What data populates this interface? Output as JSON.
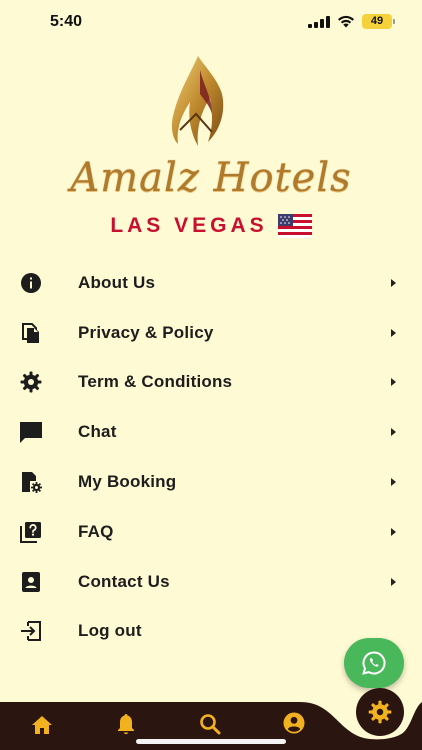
{
  "status_bar": {
    "time": "5:40",
    "battery": "49",
    "battery_color": "#F5D23B"
  },
  "brand": {
    "name": "Amalz Hotels",
    "location": "LAS VEGAS",
    "name_color": "#B07A2A",
    "location_color": "#C8102E"
  },
  "menu": {
    "items": [
      {
        "label": "About Us",
        "icon": "info-icon"
      },
      {
        "label": "Privacy & Policy",
        "icon": "documents-icon"
      },
      {
        "label": "Term & Conditions",
        "icon": "gear-icon"
      },
      {
        "label": "Chat",
        "icon": "chat-bubble-icon"
      },
      {
        "label": "My Booking",
        "icon": "booking-icon"
      },
      {
        "label": "FAQ",
        "icon": "help-icon"
      },
      {
        "label": "Contact Us",
        "icon": "contact-card-icon"
      },
      {
        "label": "Log out",
        "icon": "logout-icon"
      }
    ]
  },
  "fab": {
    "icon": "whatsapp-icon",
    "color": "#49B85A"
  },
  "bottom_nav": {
    "background": "#2B1510",
    "accent": "#F2B21F",
    "items": [
      {
        "icon": "home-icon"
      },
      {
        "icon": "bell-icon"
      },
      {
        "icon": "search-icon"
      },
      {
        "icon": "account-icon"
      },
      {
        "icon": "settings-icon",
        "active": true
      }
    ]
  },
  "colors": {
    "background": "#FEFAD3",
    "text": "#1d1d1d"
  }
}
